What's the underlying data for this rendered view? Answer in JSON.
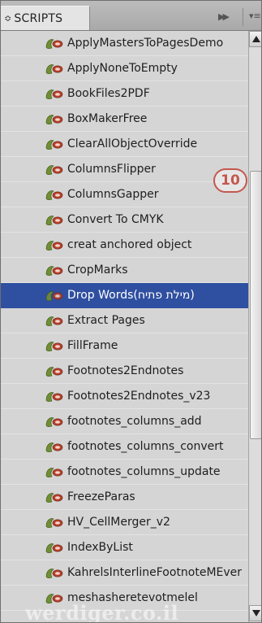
{
  "panel": {
    "tab_label": "SCRIPTS",
    "tab_prefix": "≎",
    "flyout_label": "▶▶",
    "menu_label": "▾≡"
  },
  "scripts": [
    {
      "label": "ApplyMastersToPagesDemo"
    },
    {
      "label": "ApplyNoneToEmpty"
    },
    {
      "label": "BookFiles2PDF"
    },
    {
      "label": "BoxMakerFree"
    },
    {
      "label": "ClearAllObjectOverride"
    },
    {
      "label": "ColumnsFlipper"
    },
    {
      "label": "ColumnsGapper"
    },
    {
      "label": "Convert To CMYK"
    },
    {
      "label": "creat anchored object"
    },
    {
      "label": "CropMarks"
    },
    {
      "label": "Drop Words(מילת פתיח)",
      "selected": true
    },
    {
      "label": "Extract Pages"
    },
    {
      "label": "FillFrame"
    },
    {
      "label": "Footnotes2Endnotes"
    },
    {
      "label": "Footnotes2Endnotes_v23"
    },
    {
      "label": "footnotes_columns_add"
    },
    {
      "label": "footnotes_columns_convert"
    },
    {
      "label": "footnotes_columns_update"
    },
    {
      "label": "FreezeParas"
    },
    {
      "label": "HV_CellMerger_v2"
    },
    {
      "label": "IndexByList"
    },
    {
      "label": "KahrelsInterlineFootnoteMEver"
    },
    {
      "label": "meshasheretevotmelel"
    }
  ],
  "callout": {
    "number": "10"
  },
  "watermark": {
    "text": "werdiger.co.il"
  },
  "colors": {
    "selection": "#2f4fa0",
    "callout": "#c4574f",
    "icon_green": "#6e8f33",
    "icon_red": "#b5412c"
  }
}
